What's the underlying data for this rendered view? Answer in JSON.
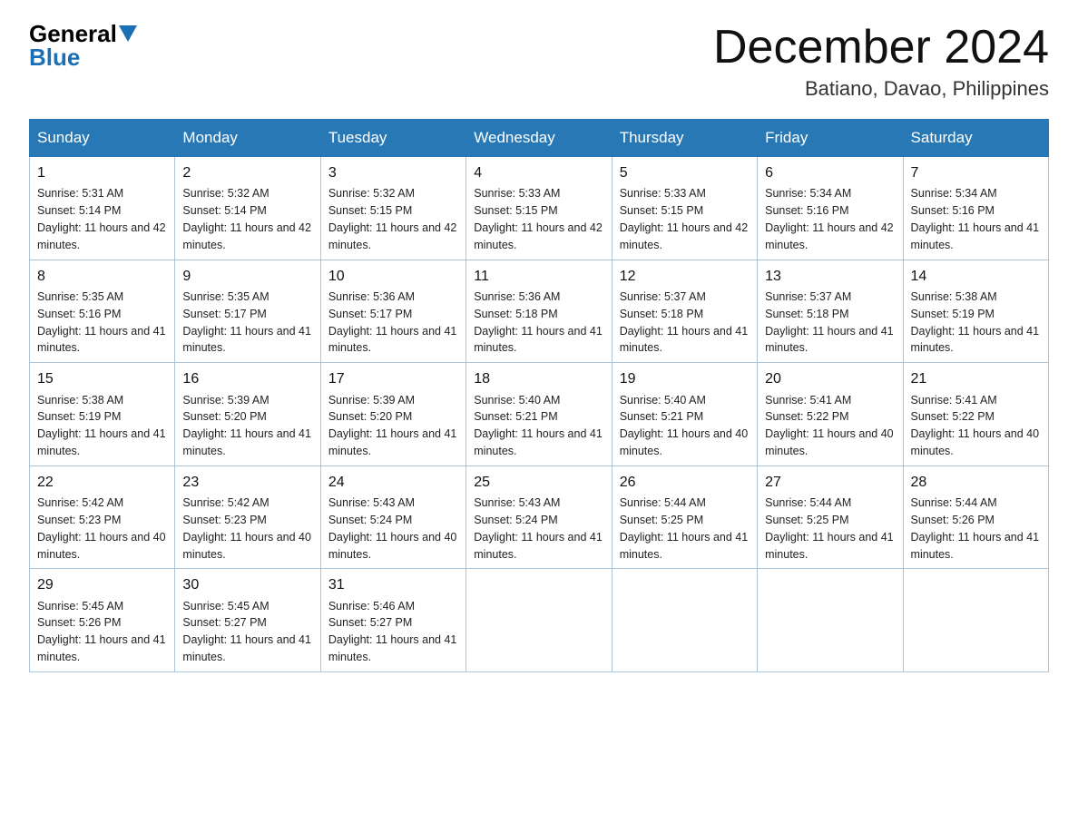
{
  "logo": {
    "general": "General",
    "blue": "Blue"
  },
  "title": "December 2024",
  "location": "Batiano, Davao, Philippines",
  "days_of_week": [
    "Sunday",
    "Monday",
    "Tuesday",
    "Wednesday",
    "Thursday",
    "Friday",
    "Saturday"
  ],
  "weeks": [
    [
      {
        "day": "1",
        "sunrise": "5:31 AM",
        "sunset": "5:14 PM",
        "daylight": "11 hours and 42 minutes."
      },
      {
        "day": "2",
        "sunrise": "5:32 AM",
        "sunset": "5:14 PM",
        "daylight": "11 hours and 42 minutes."
      },
      {
        "day": "3",
        "sunrise": "5:32 AM",
        "sunset": "5:15 PM",
        "daylight": "11 hours and 42 minutes."
      },
      {
        "day": "4",
        "sunrise": "5:33 AM",
        "sunset": "5:15 PM",
        "daylight": "11 hours and 42 minutes."
      },
      {
        "day": "5",
        "sunrise": "5:33 AM",
        "sunset": "5:15 PM",
        "daylight": "11 hours and 42 minutes."
      },
      {
        "day": "6",
        "sunrise": "5:34 AM",
        "sunset": "5:16 PM",
        "daylight": "11 hours and 42 minutes."
      },
      {
        "day": "7",
        "sunrise": "5:34 AM",
        "sunset": "5:16 PM",
        "daylight": "11 hours and 41 minutes."
      }
    ],
    [
      {
        "day": "8",
        "sunrise": "5:35 AM",
        "sunset": "5:16 PM",
        "daylight": "11 hours and 41 minutes."
      },
      {
        "day": "9",
        "sunrise": "5:35 AM",
        "sunset": "5:17 PM",
        "daylight": "11 hours and 41 minutes."
      },
      {
        "day": "10",
        "sunrise": "5:36 AM",
        "sunset": "5:17 PM",
        "daylight": "11 hours and 41 minutes."
      },
      {
        "day": "11",
        "sunrise": "5:36 AM",
        "sunset": "5:18 PM",
        "daylight": "11 hours and 41 minutes."
      },
      {
        "day": "12",
        "sunrise": "5:37 AM",
        "sunset": "5:18 PM",
        "daylight": "11 hours and 41 minutes."
      },
      {
        "day": "13",
        "sunrise": "5:37 AM",
        "sunset": "5:18 PM",
        "daylight": "11 hours and 41 minutes."
      },
      {
        "day": "14",
        "sunrise": "5:38 AM",
        "sunset": "5:19 PM",
        "daylight": "11 hours and 41 minutes."
      }
    ],
    [
      {
        "day": "15",
        "sunrise": "5:38 AM",
        "sunset": "5:19 PM",
        "daylight": "11 hours and 41 minutes."
      },
      {
        "day": "16",
        "sunrise": "5:39 AM",
        "sunset": "5:20 PM",
        "daylight": "11 hours and 41 minutes."
      },
      {
        "day": "17",
        "sunrise": "5:39 AM",
        "sunset": "5:20 PM",
        "daylight": "11 hours and 41 minutes."
      },
      {
        "day": "18",
        "sunrise": "5:40 AM",
        "sunset": "5:21 PM",
        "daylight": "11 hours and 41 minutes."
      },
      {
        "day": "19",
        "sunrise": "5:40 AM",
        "sunset": "5:21 PM",
        "daylight": "11 hours and 40 minutes."
      },
      {
        "day": "20",
        "sunrise": "5:41 AM",
        "sunset": "5:22 PM",
        "daylight": "11 hours and 40 minutes."
      },
      {
        "day": "21",
        "sunrise": "5:41 AM",
        "sunset": "5:22 PM",
        "daylight": "11 hours and 40 minutes."
      }
    ],
    [
      {
        "day": "22",
        "sunrise": "5:42 AM",
        "sunset": "5:23 PM",
        "daylight": "11 hours and 40 minutes."
      },
      {
        "day": "23",
        "sunrise": "5:42 AM",
        "sunset": "5:23 PM",
        "daylight": "11 hours and 40 minutes."
      },
      {
        "day": "24",
        "sunrise": "5:43 AM",
        "sunset": "5:24 PM",
        "daylight": "11 hours and 40 minutes."
      },
      {
        "day": "25",
        "sunrise": "5:43 AM",
        "sunset": "5:24 PM",
        "daylight": "11 hours and 41 minutes."
      },
      {
        "day": "26",
        "sunrise": "5:44 AM",
        "sunset": "5:25 PM",
        "daylight": "11 hours and 41 minutes."
      },
      {
        "day": "27",
        "sunrise": "5:44 AM",
        "sunset": "5:25 PM",
        "daylight": "11 hours and 41 minutes."
      },
      {
        "day": "28",
        "sunrise": "5:44 AM",
        "sunset": "5:26 PM",
        "daylight": "11 hours and 41 minutes."
      }
    ],
    [
      {
        "day": "29",
        "sunrise": "5:45 AM",
        "sunset": "5:26 PM",
        "daylight": "11 hours and 41 minutes."
      },
      {
        "day": "30",
        "sunrise": "5:45 AM",
        "sunset": "5:27 PM",
        "daylight": "11 hours and 41 minutes."
      },
      {
        "day": "31",
        "sunrise": "5:46 AM",
        "sunset": "5:27 PM",
        "daylight": "11 hours and 41 minutes."
      },
      null,
      null,
      null,
      null
    ]
  ]
}
